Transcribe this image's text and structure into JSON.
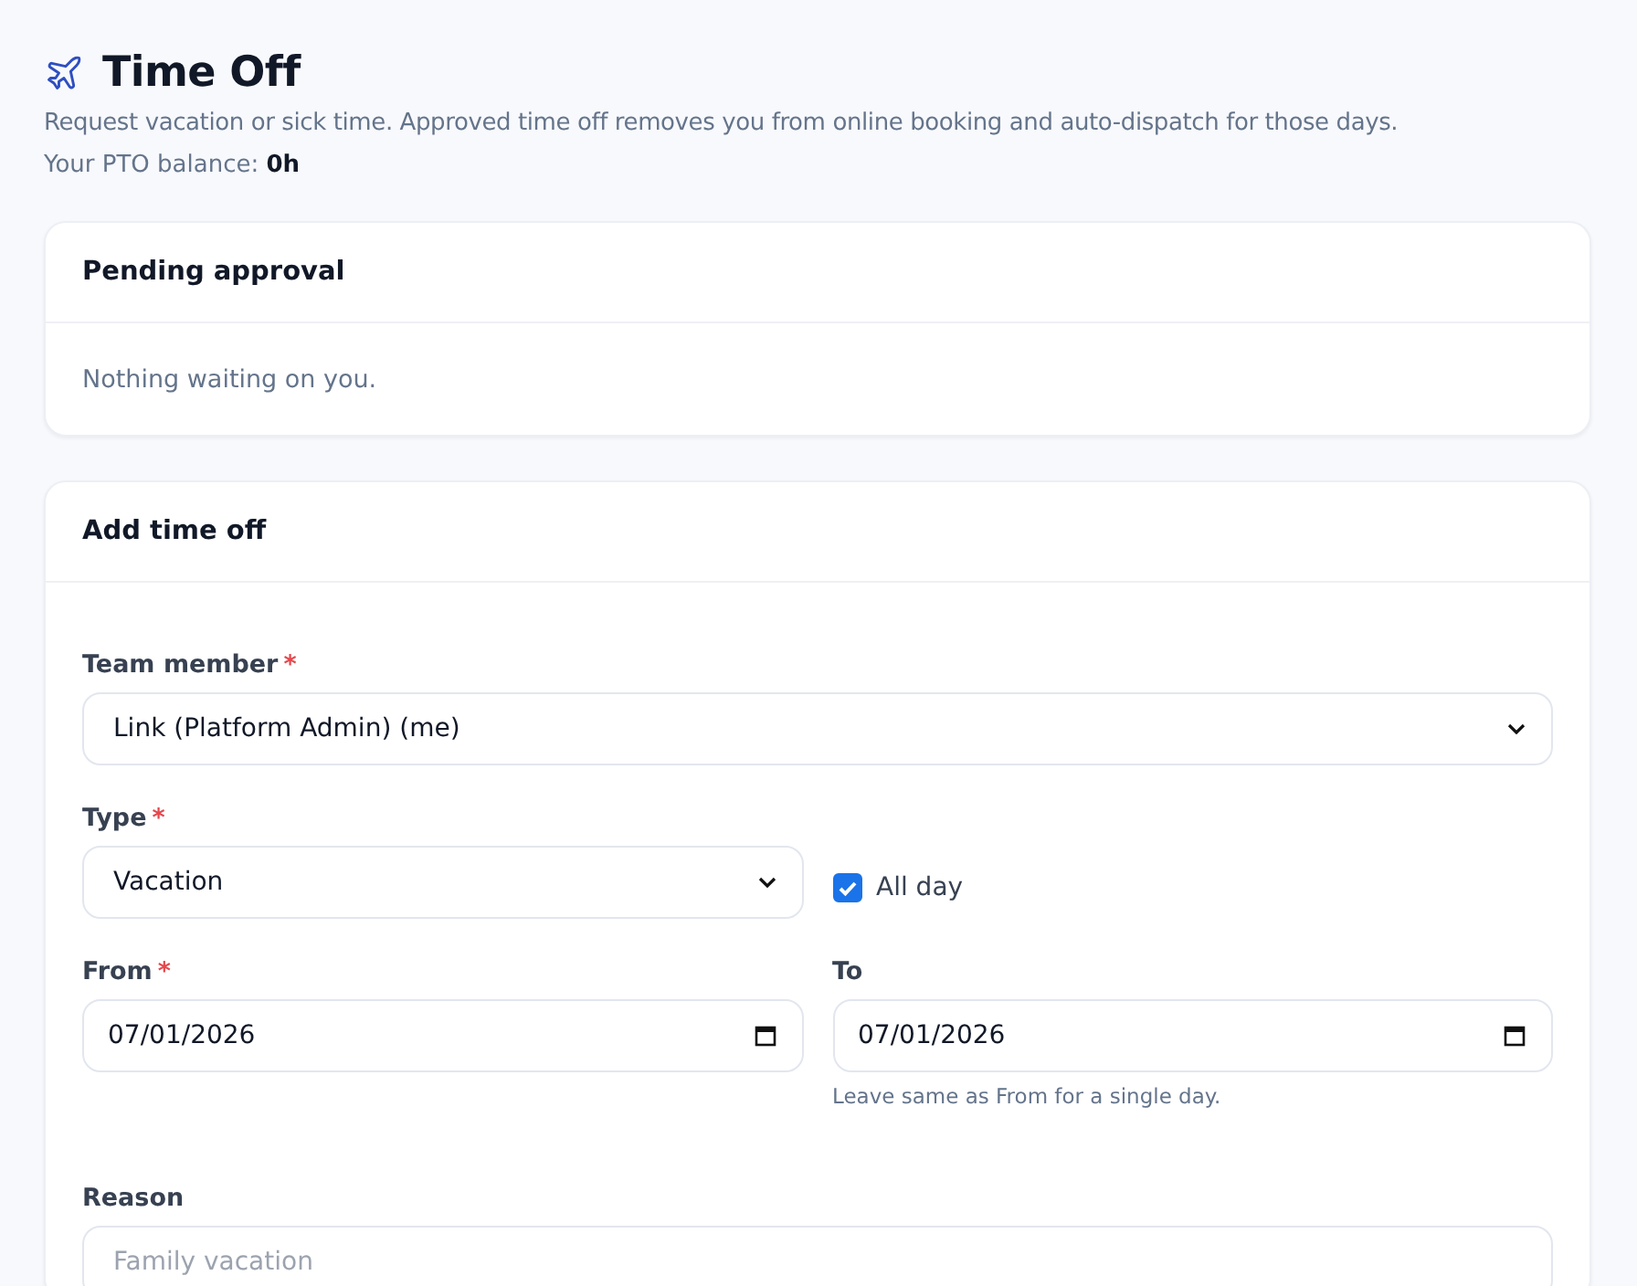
{
  "header": {
    "title": "Time Off",
    "description": "Request vacation or sick time. Approved time off removes you from online booking and auto-dispatch for those days.",
    "balance_label": "Your PTO balance:",
    "balance_value": "0h"
  },
  "pending_card": {
    "title": "Pending approval",
    "empty_text": "Nothing waiting on you."
  },
  "form_card": {
    "title": "Add time off",
    "team_member": {
      "label": "Team member",
      "required_mark": "*",
      "value": "Link (Platform Admin) (me)"
    },
    "type": {
      "label": "Type",
      "required_mark": "*",
      "value": "Vacation"
    },
    "all_day": {
      "label": "All day",
      "checked": true
    },
    "from": {
      "label": "From",
      "required_mark": "*",
      "value": "07/01/2026"
    },
    "to": {
      "label": "To",
      "value": "07/01/2026",
      "hint": "Leave same as From for a single day."
    },
    "reason": {
      "label": "Reason",
      "placeholder": "Family vacation"
    }
  }
}
